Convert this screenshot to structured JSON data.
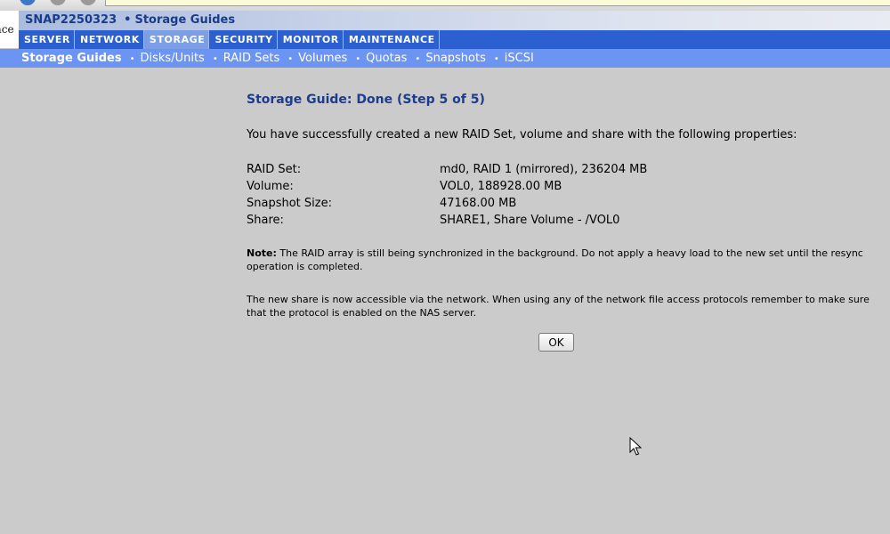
{
  "logo": {
    "fragment_text": "nce"
  },
  "title_bar": {
    "host": "SNAP2250323",
    "separator": "•",
    "section": "Storage Guides"
  },
  "main_nav": {
    "tabs": [
      {
        "label": "SERVER",
        "active": false
      },
      {
        "label": "NETWORK",
        "active": false
      },
      {
        "label": "STORAGE",
        "active": true
      },
      {
        "label": "SECURITY",
        "active": false
      },
      {
        "label": "MONITOR",
        "active": false
      },
      {
        "label": "MAINTENANCE",
        "active": false
      }
    ]
  },
  "sub_nav": {
    "bullet": "•",
    "items": [
      {
        "label": "Storage Guides",
        "active": true
      },
      {
        "label": "Disks/Units",
        "active": false
      },
      {
        "label": "RAID Sets",
        "active": false
      },
      {
        "label": "Volumes",
        "active": false
      },
      {
        "label": "Quotas",
        "active": false
      },
      {
        "label": "Snapshots",
        "active": false
      },
      {
        "label": "iSCSI",
        "active": false
      }
    ]
  },
  "content": {
    "heading": "Storage Guide: Done (Step 5 of 5)",
    "intro": "You have successfully created a new RAID Set, volume and share with the following properties:",
    "properties": [
      {
        "label": "RAID Set:",
        "value": "md0, RAID 1 (mirrored), 236204 MB"
      },
      {
        "label": "Volume:",
        "value": "VOL0, 188928.00 MB"
      },
      {
        "label": "Snapshot Size:",
        "value": "47168.00 MB"
      },
      {
        "label": "Share:",
        "value": "SHARE1, Share Volume - /VOL0"
      }
    ],
    "note_label": "Note:",
    "note_text": " The RAID array is still being synchronized in the background. Do not apply a heavy load to the new set until the resync operation is completed.",
    "access_text": "The new share is now accessible via the network. When using any of the network file access protocols remember to make sure that the protocol is enabled on the NAS server.",
    "ok_label": "OK"
  },
  "icons": {
    "browser_back": "back-icon",
    "browser_stop": "stop-icon",
    "browser_page": "page-icon",
    "cursor": "mouse-cursor-icon"
  },
  "colors": {
    "title_text": "#1a3c8c",
    "main_nav_bg": "#2c5fd0",
    "main_nav_active": "#7b9ee4",
    "sub_nav_bg": "#6c94f2",
    "page_bg": "#cbcbcb",
    "heading_text": "#1e3c8c"
  }
}
